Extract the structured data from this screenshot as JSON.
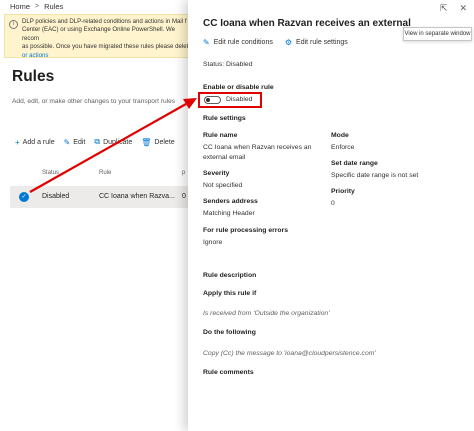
{
  "breadcrumb": {
    "home": "Home",
    "separator": ">",
    "current": "Rules"
  },
  "notice": {
    "text": "DLP policies and DLP-related conditions and actions in Mail f\nCenter (EAC) or using Exchange Online PowerShell. We recom\nas possible. Once you have migrated these rules please delet",
    "link": "or actions"
  },
  "page": {
    "title": "Rules",
    "description": "Add, edit, or make other changes to your transport rules"
  },
  "toolbar": {
    "add": "Add a rule",
    "edit": "Edit",
    "duplicate": "Duplicate",
    "delete": "Delete"
  },
  "grid": {
    "headers": {
      "status": "Status",
      "rule": "Rule",
      "priority": "p"
    },
    "row": {
      "status": "Disabled",
      "rule": "CC Ioana when Razva...",
      "priority": "0"
    }
  },
  "panel": {
    "tooltip": "View in separate window",
    "title": "CC Ioana when Razvan receives an external",
    "edit_conditions": "Edit rule conditions",
    "edit_settings": "Edit rule settings",
    "status": "Status: Disabled",
    "enable_label": "Enable or disable rule",
    "toggle_text": "Disabled",
    "rule_settings_head": "Rule settings",
    "rule_name_label": "Rule name",
    "rule_name_value": "CC Ioana when Razvan receives an external email",
    "mode_label": "Mode",
    "mode_value": "Enforce",
    "date_range_label": "Set date range",
    "date_range_value": "Specific date range is not set",
    "severity_label": "Severity",
    "severity_value": "Not specified",
    "priority_label": "Priority",
    "priority_value": "0",
    "senders_label": "Senders address",
    "senders_value": "Matching Header",
    "errors_label": "For rule processing errors",
    "errors_value": "Ignore",
    "description_head": "Rule description",
    "apply_head": "Apply this rule if",
    "apply_value": "Is received from 'Outside the organization'",
    "do_head": "Do the following",
    "do_value": "Copy (Cc) the message to 'ioana@cloudpersistence.com'",
    "comments_head": "Rule comments"
  },
  "colors": {
    "accent": "#0078d4",
    "annotation": "#e00000",
    "notice_bg": "#fff4ce"
  }
}
